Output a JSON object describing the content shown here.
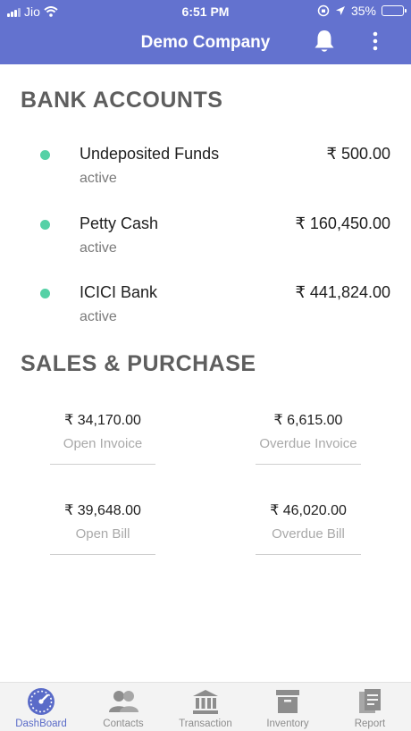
{
  "status_bar": {
    "carrier": "Jio",
    "time": "6:51 PM",
    "battery": "35%",
    "battery_level": 0.35
  },
  "header": {
    "title": "Demo Company"
  },
  "bank_accounts": {
    "title": "BANK ACCOUNTS",
    "items": [
      {
        "name": "Undeposited Funds",
        "status": "active",
        "amount": "₹ 500.00"
      },
      {
        "name": "Petty Cash",
        "status": "active",
        "amount": "₹ 160,450.00"
      },
      {
        "name": "ICICI Bank",
        "status": "active",
        "amount": "₹ 441,824.00"
      }
    ]
  },
  "sales_purchase": {
    "title": "SALES & PURCHASE",
    "items": [
      {
        "value": "₹ 34,170.00",
        "label": "Open Invoice"
      },
      {
        "value": "₹ 6,615.00",
        "label": "Overdue Invoice"
      },
      {
        "value": "₹ 39,648.00",
        "label": "Open Bill"
      },
      {
        "value": "₹ 46,020.00",
        "label": "Overdue Bill"
      }
    ]
  },
  "bottom_nav": {
    "active": "DashBoard",
    "tabs": [
      {
        "label": "DashBoard",
        "icon": "dashboard-gauge-icon"
      },
      {
        "label": "Contacts",
        "icon": "contacts-people-icon"
      },
      {
        "label": "Transaction",
        "icon": "bank-building-icon"
      },
      {
        "label": "Inventory",
        "icon": "inventory-box-icon"
      },
      {
        "label": "Report",
        "icon": "report-document-icon"
      }
    ]
  },
  "colors": {
    "primary": "#6372cf",
    "active_tab": "#5a6bc8",
    "status_dot": "#55d1a6"
  }
}
